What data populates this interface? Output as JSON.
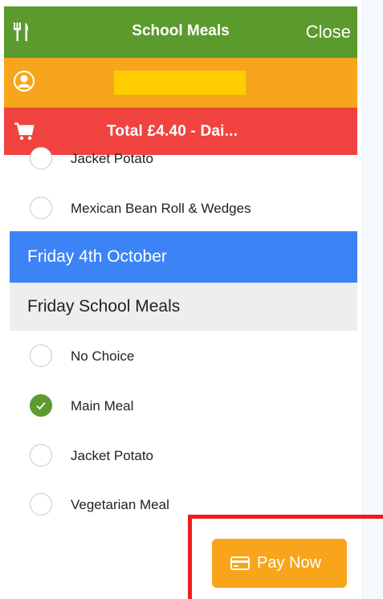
{
  "header": {
    "title": "School Meals",
    "close_label": "Close",
    "icon": "fork-knife-icon",
    "color": "#5b9a2c"
  },
  "user_bar": {
    "icon": "user-icon",
    "color": "#f7a51c",
    "name_highlight_color": "#ffcc00"
  },
  "cart_bar": {
    "icon": "cart-icon",
    "total": "Total £4.40 - Dai...",
    "color": "#f0433f"
  },
  "thursday_options": [
    {
      "label": "Jacket Potato",
      "selected": false
    },
    {
      "label": "Mexican Bean Roll & Wedges",
      "selected": false
    }
  ],
  "friday": {
    "day": "Friday 4th October",
    "section": "Friday School Meals",
    "options": [
      {
        "label": "No Choice",
        "selected": false
      },
      {
        "label": "Main Meal",
        "selected": true
      },
      {
        "label": "Jacket Potato",
        "selected": false
      },
      {
        "label": "Vegetarian Meal",
        "selected": false
      }
    ]
  },
  "pay_button": {
    "label": "Pay Now",
    "icon": "credit-card-icon",
    "color": "#f9a51c"
  },
  "highlight_color": "#ee1c1c"
}
